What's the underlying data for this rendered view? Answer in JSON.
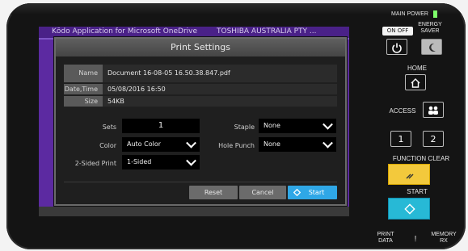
{
  "screen": {
    "topbar_left": "Kōdo Application for Microsoft OneDrive",
    "topbar_right": "TOSHIBA AUSTRALIA PTY ..."
  },
  "dialog": {
    "title": "Print Settings",
    "info": [
      {
        "label": "Name",
        "value": "Document 16-08-05 16.50.38.847.pdf"
      },
      {
        "label": "Date,Time",
        "value": "05/08/2016 16:50"
      },
      {
        "label": "Size",
        "value": "54KB"
      }
    ],
    "settings": {
      "sets_label": "Sets",
      "sets_value": "1",
      "color_label": "Color",
      "color_value": "Auto Color",
      "two_sided_label": "2-Sided Print",
      "two_sided_value": "1-Sided",
      "staple_label": "Staple",
      "staple_value": "None",
      "hole_punch_label": "Hole Punch",
      "hole_punch_value": "None"
    },
    "buttons": {
      "reset": "Reset",
      "cancel": "Cancel",
      "start": "Start"
    }
  },
  "device_panel": {
    "main_power": "MAIN POWER",
    "on_off": "ON OFF",
    "energy_saver": "ENERGY SAVER",
    "home": "HOME",
    "access": "ACCESS",
    "key_1": "1",
    "key_2": "2",
    "function_clear": "FUNCTION CLEAR",
    "start": "START",
    "print_data": "PRINT DATA",
    "exclamation": "!",
    "memory_rx": "MEMORY RX"
  },
  "colors": {
    "screen_purple": "#5c2aa1",
    "start_blue": "#2fa7e6",
    "function_clear_yellow": "#f3c93c",
    "start_key_cyan": "#27b9d6",
    "power_led": "#7dff6a"
  },
  "icons": [
    "power-icon",
    "moon-icon",
    "home-icon",
    "access-user-icon",
    "function-clear-slash-icon",
    "start-diamond-icon"
  ]
}
